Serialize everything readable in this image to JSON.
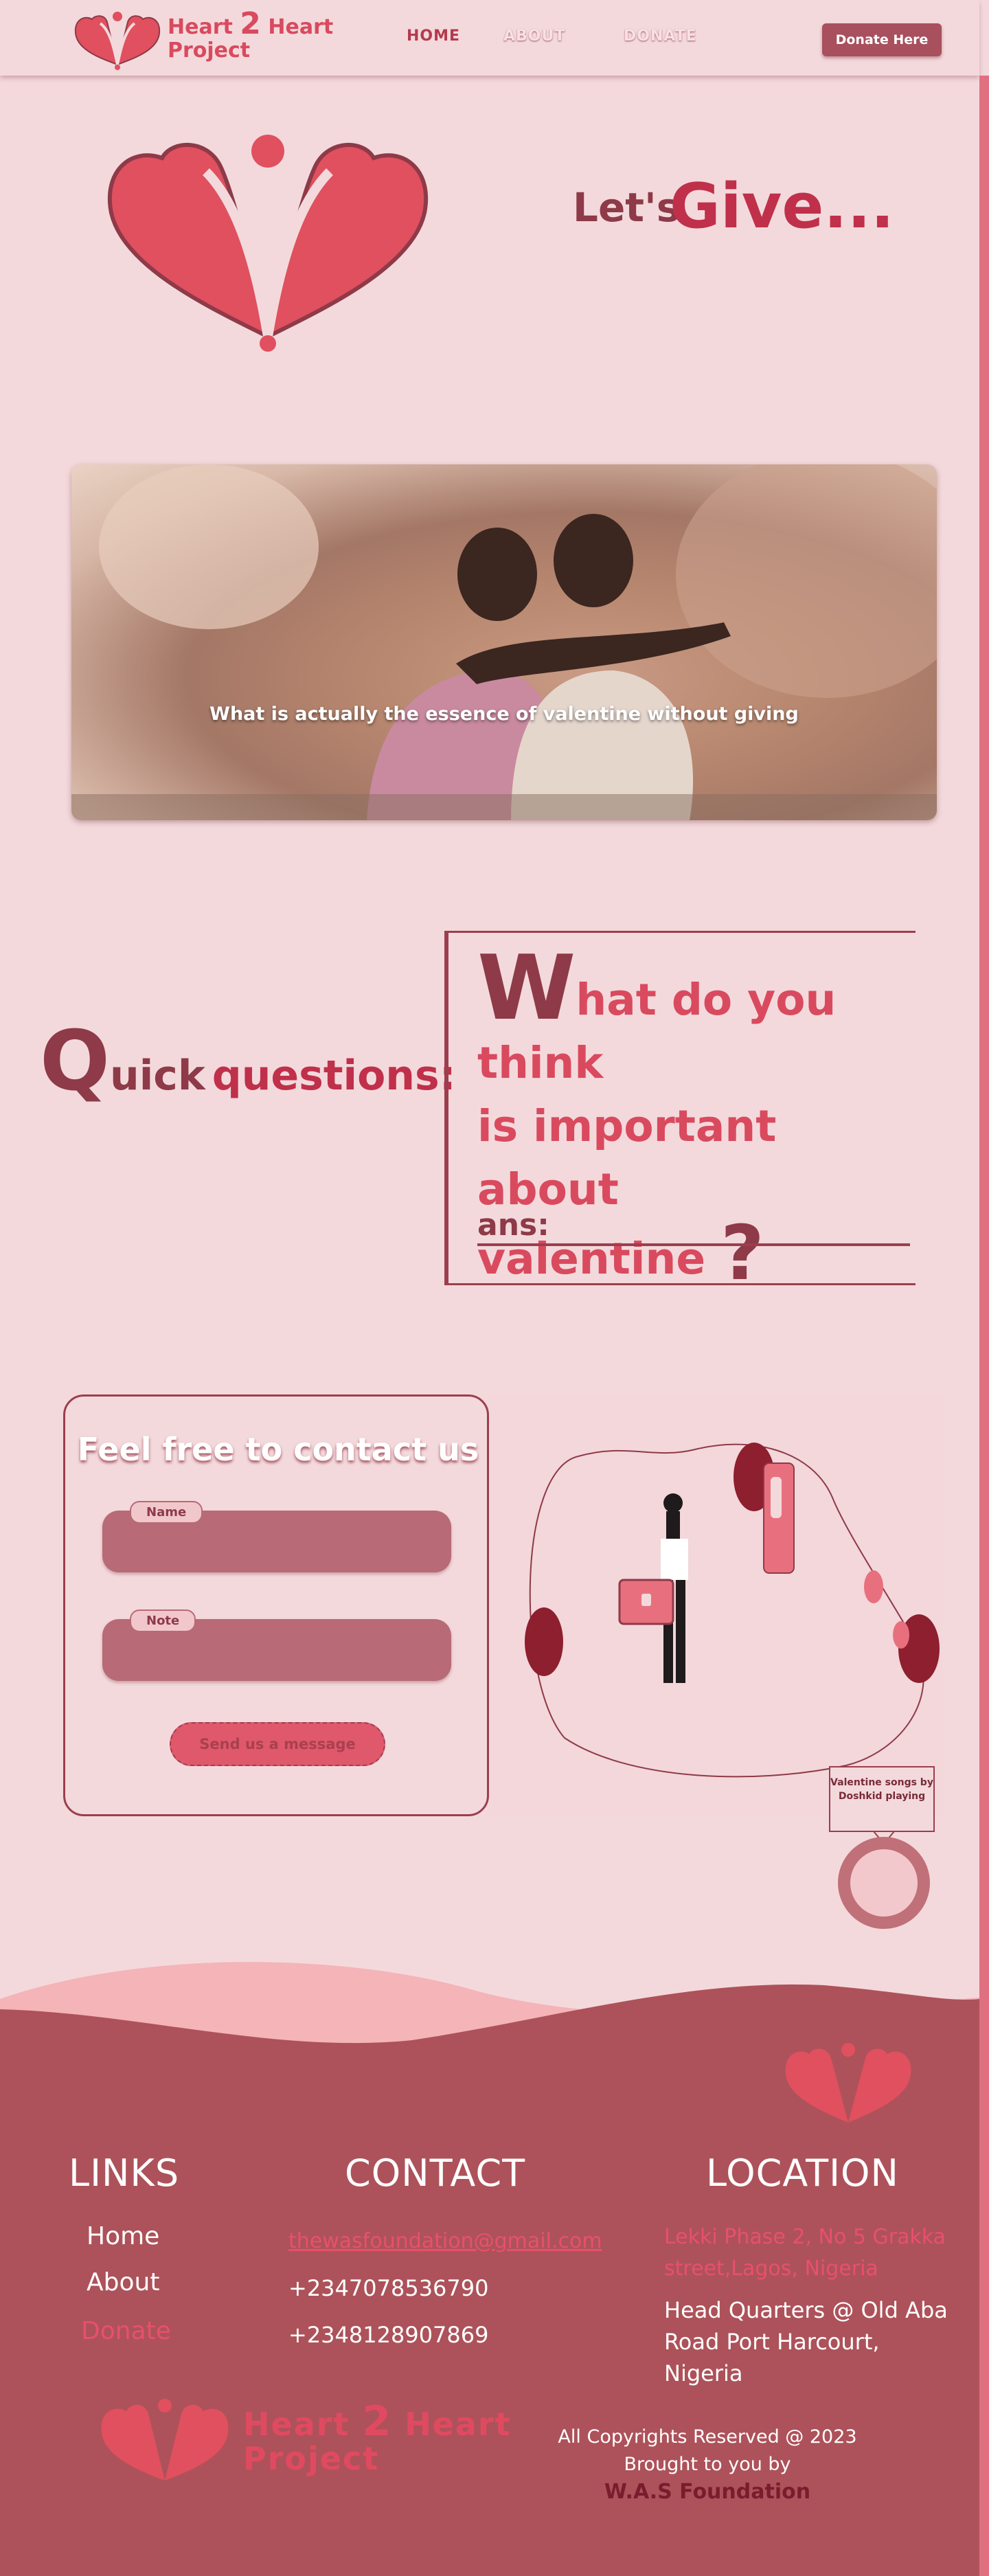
{
  "header": {
    "brand_line1": "Heart",
    "brand_two": "2",
    "brand_line1b": "Heart",
    "brand_line2": "Project",
    "nav": [
      "HOME",
      "ABOUT",
      "DONATE"
    ],
    "cta": "Donate Here"
  },
  "hero": {
    "lets": "Let's",
    "give": "Give..."
  },
  "banner": {
    "caption": "What is actually the essence of valentine without giving"
  },
  "questions": {
    "quick_big": "Q",
    "quick_rest": "uick",
    "questions_word": "questions:",
    "w_big": "W",
    "text_line1": "hat do you think",
    "text_line2": "is important about",
    "text_line3": "valentine",
    "qmark": "?",
    "ans_label": "ans:"
  },
  "contact": {
    "title": "Feel free to contact us",
    "name_label": "Name",
    "note_label": "Note",
    "send": "Send us a message"
  },
  "player": {
    "label": "Valentine songs by Doshkid playing"
  },
  "footer": {
    "links_title": "LINKS",
    "links": [
      "Home",
      "About",
      "Donate"
    ],
    "contact_title": "CONTACT",
    "email": "thewasfoundation@gmail.com",
    "phone1": "+2347078536790",
    "phone2": "+2348128907869",
    "location_title": "LOCATION",
    "address1": "Lekki Phase 2, No 5 Grakka street,Lagos, Nigeria",
    "address2": "Head Quarters @ Old Aba Road Port Harcourt, Nigeria",
    "copyright": "All Copyrights Reserved @ 2023",
    "brought": "Brought to you by",
    "foundation": "W.A.S Foundation",
    "brand_line1": "Heart",
    "brand_two": "2",
    "brand_line1b": "Heart",
    "brand_line2": "Project"
  },
  "colors": {
    "background": "#f3d9dc",
    "accent": "#d94a5e",
    "dark": "#8e3a48",
    "footer": "#ad525a"
  }
}
